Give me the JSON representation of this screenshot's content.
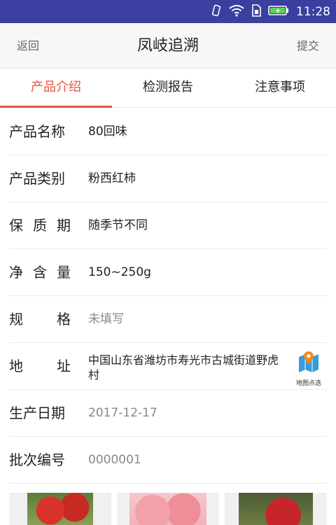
{
  "status_bar": {
    "time": "11:28",
    "icons": [
      "vibrate-icon",
      "wifi-icon",
      "sim-icon",
      "battery-icon"
    ]
  },
  "header": {
    "back_label": "返回",
    "title": "凤岐追溯",
    "submit_label": "提交"
  },
  "tabs": [
    {
      "label": "产品介绍",
      "active": true
    },
    {
      "label": "检测报告",
      "active": false
    },
    {
      "label": "注意事项",
      "active": false
    }
  ],
  "fields": [
    {
      "label": "产品名称",
      "value": "80回味"
    },
    {
      "label": "产品类别",
      "value": "粉西红柿"
    },
    {
      "label": "保质期",
      "value": "随季节不同"
    },
    {
      "label": "净含量",
      "value": "150~250g"
    },
    {
      "label": "规格",
      "value": "未填写"
    },
    {
      "label": "地址",
      "value": "中国山东省潍坊市寿光市古城街道野虎村",
      "action": "地图点选"
    },
    {
      "label": "生产日期",
      "value": "2017-12-17"
    },
    {
      "label": "批次编号",
      "value": "0000001"
    }
  ],
  "photos": [
    "tomato-photo-1",
    "tomato-photo-2",
    "tomato-photo-3"
  ],
  "colors": {
    "status_bar": "#3a3fa0",
    "accent": "#e8523f",
    "map_icon": "#3a9bd8"
  }
}
